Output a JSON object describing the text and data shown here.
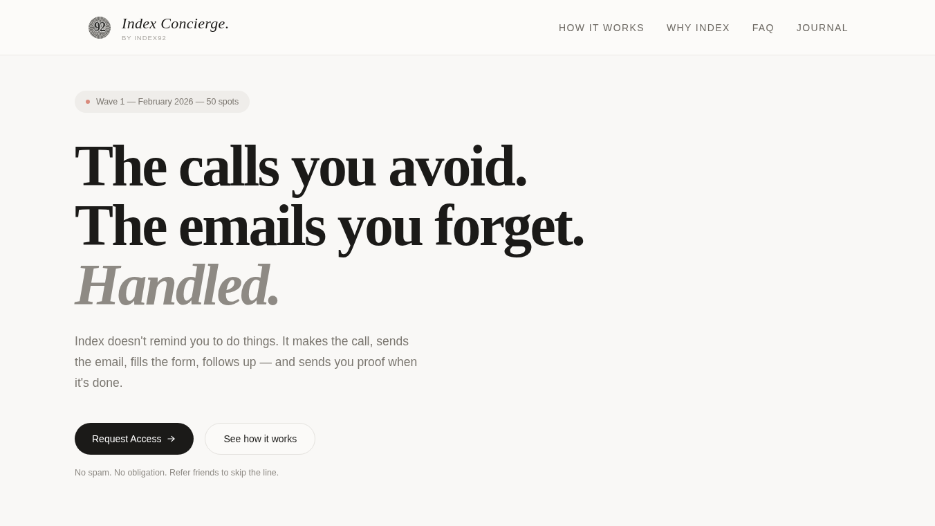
{
  "header": {
    "logo_mark": "92",
    "brand": "Index Concierge.",
    "byline": "BY INDEX92",
    "nav": [
      "HOW IT WORKS",
      "WHY INDEX",
      "FAQ",
      "JOURNAL"
    ]
  },
  "hero": {
    "badge": "Wave 1 — February 2026 — 50 spots",
    "headline_lines": [
      "The calls you avoid.",
      "The emails you forget."
    ],
    "headline_accent": "Handled.",
    "lede": "Index doesn't remind you to do things. It makes the call, sends the email, fills the form, follows up — and sends you proof when it's done.",
    "buttons": [
      {
        "label": "Request Access",
        "kind": "primary"
      },
      {
        "label": "See how it works",
        "kind": "secondary"
      }
    ],
    "note": "No spam. No obligation. Refer friends to skip the line."
  }
}
